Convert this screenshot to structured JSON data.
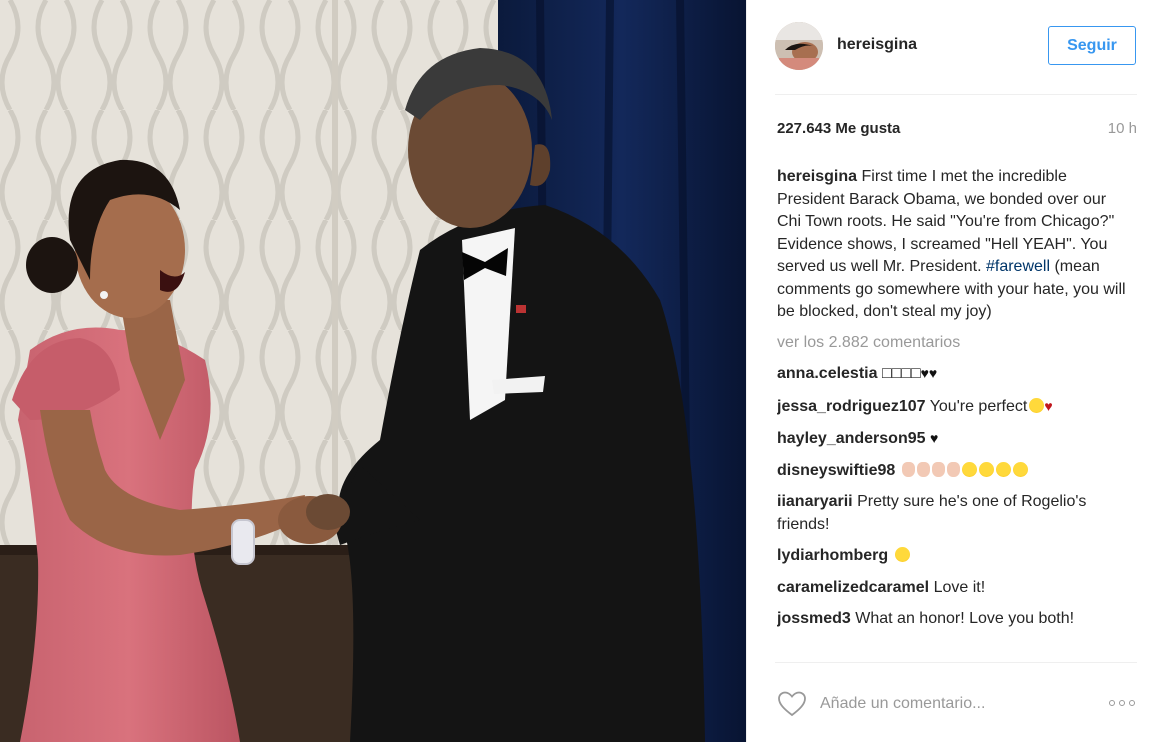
{
  "post": {
    "username": "hereisgina",
    "follow_label": "Seguir",
    "likes": "227.643 Me gusta",
    "time": "10 h",
    "caption": {
      "username": "hereisgina",
      "text_before_hashtag": "First time I met the incredible President Barack Obama, we bonded over our Chi Town roots. He said \"You're from Chicago?\" Evidence shows, I screamed \"Hell YEAH\". You served us well Mr. President.",
      "hashtag": "#farewell",
      "text_after_hashtag": "(mean comments go somewhere with your hate, you will be blocked, don't steal my joy)"
    },
    "view_all_comments": "ver los 2.882 comentarios",
    "comments": [
      {
        "username": "anna.celestia",
        "text": "□□□□",
        "trailing": "♥♥"
      },
      {
        "username": "jessa_rodriguez107",
        "text": "You're perfect"
      },
      {
        "username": "hayley_anderson95",
        "text": "",
        "trailing": "♥"
      },
      {
        "username": "disneyswiftie98",
        "text": ""
      },
      {
        "username": "iianaryarii",
        "text": "Pretty sure he's one of Rogelio's friends!"
      },
      {
        "username": "lydiarhomberg",
        "text": ""
      },
      {
        "username": "caramelizedcaramel",
        "text": "Love it!"
      },
      {
        "username": "jossmed3",
        "text": "What an honor! Love you both!"
      }
    ],
    "add_comment_placeholder": "Añade un comentario...",
    "icons": {
      "like": "heart-outline-icon",
      "more": "more-options-icon"
    },
    "colors": {
      "link_blue": "#3897f0",
      "hashtag": "#003569",
      "muted": "#999999"
    }
  }
}
